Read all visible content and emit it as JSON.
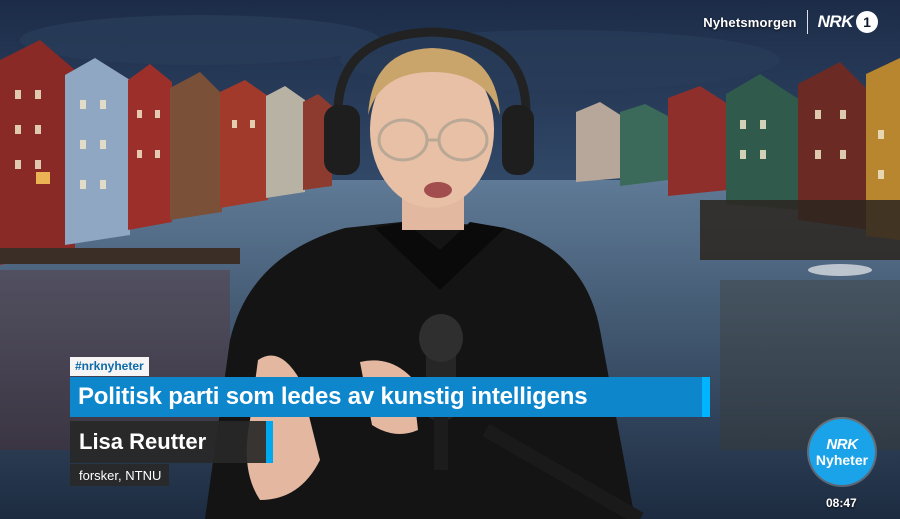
{
  "channel": {
    "show_name": "Nyhetsmorgen",
    "logo_text": "NRK",
    "logo_number": "1"
  },
  "lower_third": {
    "hashtag": "#nrknyheter",
    "headline": "Politisk parti som ledes av kunstig intelligens",
    "speaker_name": "Lisa Reutter",
    "speaker_title": "forsker, NTNU"
  },
  "corner_logo": {
    "line1": "NRK",
    "line2": "Nyheter"
  },
  "clock": "08:47",
  "icons": [
    "nrk1-logo-icon",
    "nrk-nyheter-logo-icon",
    "headphones-icon",
    "microphone-icon"
  ],
  "colors": {
    "headline_bg": "#0e86cc",
    "accent": "#00b4ff",
    "name_bg": "#282828",
    "logo_bg": "#1aa3e8"
  }
}
